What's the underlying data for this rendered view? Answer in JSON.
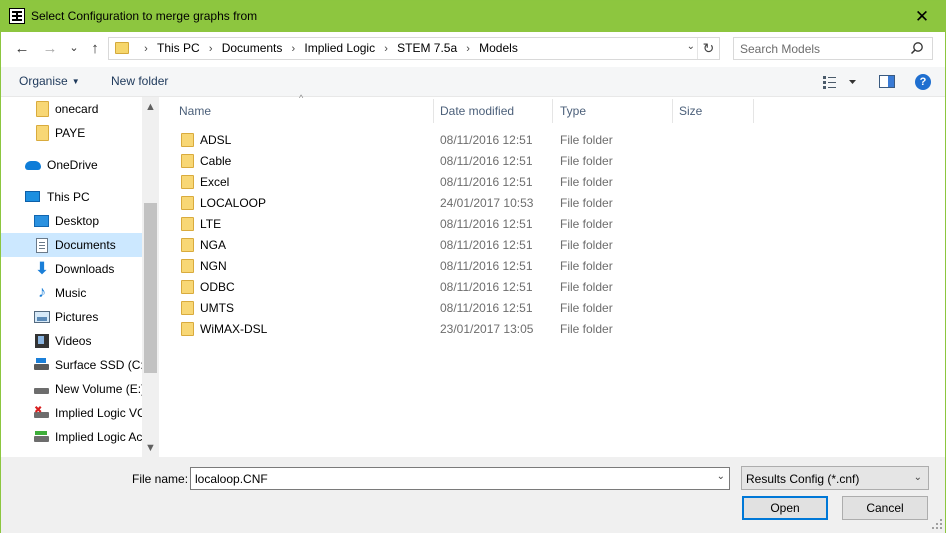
{
  "window": {
    "title": "Select Configuration to merge graphs from",
    "close_glyph": "✕"
  },
  "nav_buttons": {
    "back": "←",
    "forward": "→",
    "recent": "⌄",
    "up": "↑"
  },
  "address": {
    "crumbs": [
      "This PC",
      "Documents",
      "Implied Logic",
      "STEM 7.5a",
      "Models"
    ],
    "separator": "›",
    "dropdown_glyph": "⌄",
    "refresh_glyph": "↻"
  },
  "search": {
    "placeholder": "Search Models"
  },
  "toolbar": {
    "organise": "Organise",
    "caret": "▼",
    "new_folder": "New folder",
    "help": "?"
  },
  "nav_pane": {
    "items": [
      {
        "label": "onecard",
        "icon": "folder-icon"
      },
      {
        "label": "PAYE",
        "icon": "folder-icon"
      },
      {
        "label": "OneDrive",
        "icon": "onedrive-icon"
      },
      {
        "label": "This PC",
        "icon": "computer-icon"
      },
      {
        "label": "Desktop",
        "icon": "desktop-icon"
      },
      {
        "label": "Documents",
        "icon": "documents-icon",
        "selected": true
      },
      {
        "label": "Downloads",
        "icon": "download-icon"
      },
      {
        "label": "Music",
        "icon": "music-icon"
      },
      {
        "label": "Pictures",
        "icon": "pictures-icon"
      },
      {
        "label": "Videos",
        "icon": "videos-icon"
      },
      {
        "label": "Surface SSD (C:)",
        "icon": "system-drive-icon"
      },
      {
        "label": "New Volume (E:)",
        "icon": "drive-icon"
      },
      {
        "label": "Implied Logic VC",
        "icon": "network-drive-disconnected-icon"
      },
      {
        "label": "Implied Logic Ac",
        "icon": "network-drive-icon"
      }
    ],
    "scroll_up": "▲",
    "scroll_down": "▼"
  },
  "columns": {
    "name": "Name",
    "date": "Date modified",
    "type": "Type",
    "size": "Size",
    "sort_glyph": "^"
  },
  "files": [
    {
      "name": "ADSL",
      "date": "08/11/2016 12:51",
      "type": "File folder"
    },
    {
      "name": "Cable",
      "date": "08/11/2016 12:51",
      "type": "File folder"
    },
    {
      "name": "Excel",
      "date": "08/11/2016 12:51",
      "type": "File folder"
    },
    {
      "name": "LOCALOOP",
      "date": "24/01/2017 10:53",
      "type": "File folder"
    },
    {
      "name": "LTE",
      "date": "08/11/2016 12:51",
      "type": "File folder"
    },
    {
      "name": "NGA",
      "date": "08/11/2016 12:51",
      "type": "File folder"
    },
    {
      "name": "NGN",
      "date": "08/11/2016 12:51",
      "type": "File folder"
    },
    {
      "name": "ODBC",
      "date": "08/11/2016 12:51",
      "type": "File folder"
    },
    {
      "name": "UMTS",
      "date": "08/11/2016 12:51",
      "type": "File folder"
    },
    {
      "name": "WiMAX-DSL",
      "date": "23/01/2017 13:05",
      "type": "File folder"
    }
  ],
  "footer": {
    "file_name_label": "File name:",
    "file_name_value": "localoop.CNF",
    "dropdown_glyph": "⌄",
    "file_type": "Results Config (*.cnf)",
    "open_label": "Open",
    "cancel_label": "Cancel"
  },
  "colors": {
    "titlebar": "#8dc63f",
    "selection": "#cce8ff",
    "folder": "#f8d775",
    "accent": "#0078d7"
  }
}
